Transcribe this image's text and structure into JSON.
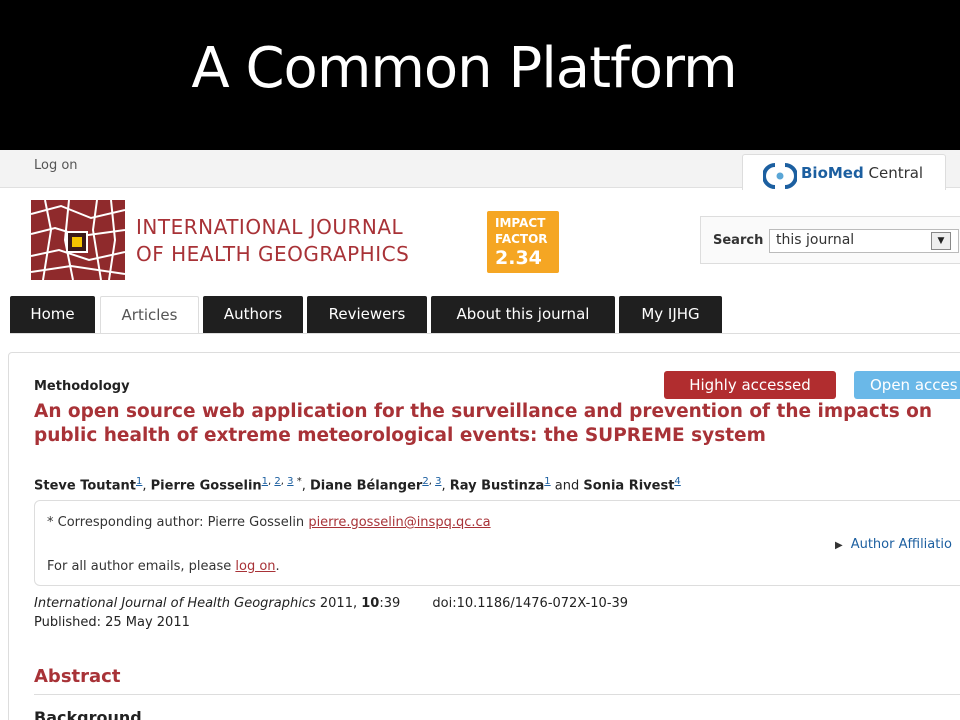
{
  "slide": {
    "title": "A Common Platform"
  },
  "topbar": {
    "logon": "Log on",
    "publisher_brand_bold": "BioMed",
    "publisher_brand_rest": " Central"
  },
  "journal": {
    "title_line1": "INTERNATIONAL JOURNAL",
    "title_line2": "OF HEALTH GEOGRAPHICS",
    "impact_label_line1": "IMPACT",
    "impact_label_line2": "FACTOR",
    "impact_value": "2.34"
  },
  "search": {
    "label": "Search",
    "selected": "this journal"
  },
  "tabs": [
    {
      "label": "Home"
    },
    {
      "label": "Articles",
      "active": true
    },
    {
      "label": "Authors"
    },
    {
      "label": "Reviewers"
    },
    {
      "label": "About this journal"
    },
    {
      "label": "My IJHG"
    }
  ],
  "article": {
    "type": "Methodology",
    "badge_highly": "Highly accessed",
    "badge_open": "Open acces",
    "title": "An open source web application for the surveillance and prevention of the impacts on public health of extreme meteorological events: the SUPREME system",
    "authors": [
      {
        "name": "Steve Toutant",
        "sups": [
          "1"
        ],
        "star": false,
        "sep": ", "
      },
      {
        "name": "Pierre Gosselin",
        "sups": [
          "1",
          "2",
          "3"
        ],
        "star": true,
        "sep": ", "
      },
      {
        "name": "Diane Bélanger",
        "sups": [
          "2",
          "3"
        ],
        "star": false,
        "sep": ", "
      },
      {
        "name": "Ray Bustinza",
        "sups": [
          "1"
        ],
        "star": false,
        "sep": " and "
      },
      {
        "name": "Sonia Rivest",
        "sups": [
          "4"
        ],
        "star": false,
        "sep": ""
      }
    ],
    "corr_prefix": "* Corresponding author: Pierre Gosselin",
    "corr_email": "pierre.gosselin@inspq.qc.ca",
    "emails_prefix": "For all author emails, please",
    "emails_link": "log on",
    "emails_suffix": ".",
    "affiliations_link": "Author Affiliatio",
    "citation_journal": "International Journal of Health Geographics",
    "citation_year": "2011,",
    "citation_volume": "10",
    "citation_pages": ":39",
    "doi": "doi:10.1186/1476-072X-10-39",
    "published": "Published: 25 May 2011",
    "abstract_heading": "Abstract",
    "background_heading": "Background"
  },
  "colors": {
    "brand_red": "#a83237",
    "impact_orange": "#f5a623",
    "badge_blue": "#6ab8e8",
    "tab_dark": "#1f1f1f"
  }
}
